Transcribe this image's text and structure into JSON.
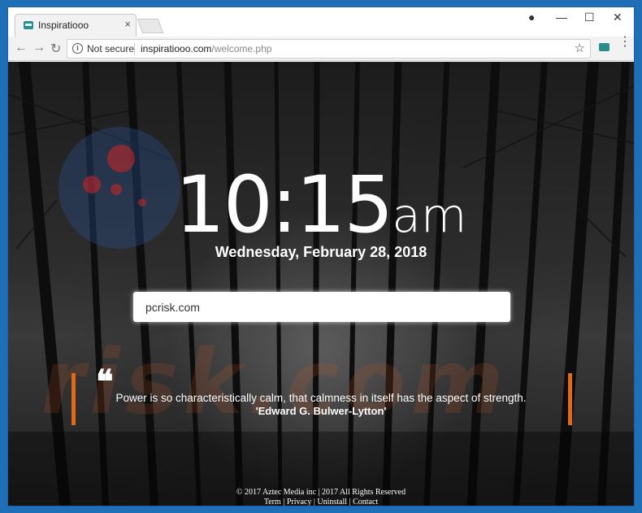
{
  "tab": {
    "title": "Inspiratiooo",
    "close": "×",
    "favicon": "inspiratiooo-favicon"
  },
  "window_controls": {
    "profile": "●",
    "minimize": "—",
    "maximize": "☐",
    "close": "✕"
  },
  "nav": {
    "back": "←",
    "forward": "→",
    "reload": "↻"
  },
  "address": {
    "security": "Not secure",
    "host": "inspiratiooo.com",
    "path": "/welcome.php",
    "info_icon": "i",
    "star": "☆"
  },
  "menu": "⋮",
  "clock": {
    "hours_minutes": "10:15",
    "ampm": "am"
  },
  "date": "Wednesday, February 28, 2018",
  "search": {
    "value": "pcrisk.com"
  },
  "quote": {
    "mark": "❝",
    "text": "Power is so characteristically calm, that calmness in itself has the aspect of strength.",
    "author": "'Edward G. Bulwer-Lytton'",
    "accent_color": "#e06a1a"
  },
  "footer": {
    "copyright": "© 2017 Aztec Media inc | 2017 All Rights Reserved",
    "links": [
      "Term",
      "Privacy",
      "Uninstall",
      "Contact"
    ],
    "separator": " | "
  }
}
